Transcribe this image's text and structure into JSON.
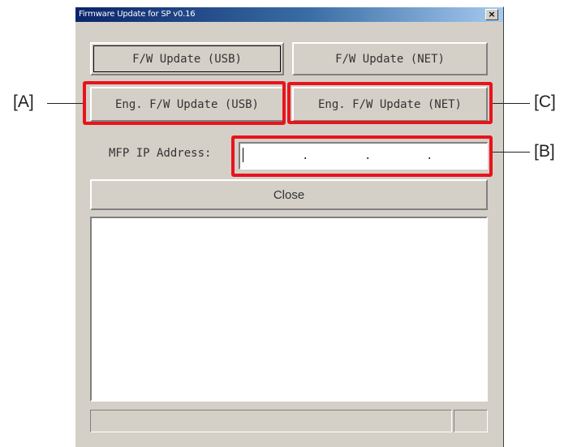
{
  "window": {
    "title": "Firmware Update for SP v0.16",
    "close_glyph": "×"
  },
  "buttons": {
    "fw_usb": "F/W Update (USB)",
    "fw_net": "F/W Update (NET)",
    "eng_fw_usb": "Eng. F/W Update (USB)",
    "eng_fw_net": "Eng. F/W Update (NET)",
    "close": "Close"
  },
  "ip": {
    "label": "MFP IP Address:",
    "separator": "."
  },
  "callouts": {
    "a": "[A]",
    "b": "[B]",
    "c": "[C]"
  },
  "colors": {
    "highlight": "#e8141c",
    "window_bg": "#d4d0c8",
    "titlebar_start": "#0a246a"
  }
}
